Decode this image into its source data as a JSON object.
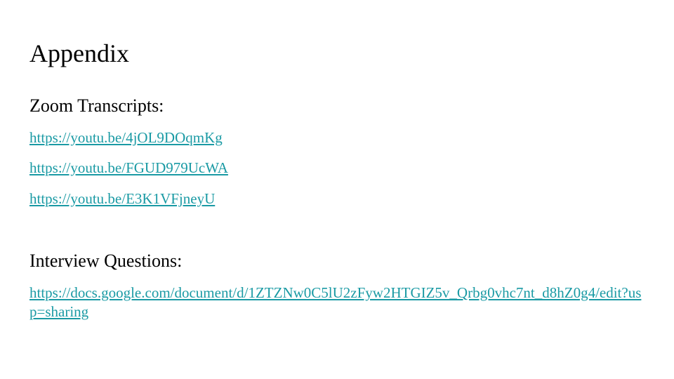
{
  "slide": {
    "title": "Appendix",
    "sections": [
      {
        "heading": "Zoom Transcripts:",
        "links": [
          "https://youtu.be/4jOL9DOqmKg",
          "https://youtu.be/FGUD979UcWA",
          "https://youtu.be/E3K1VFjneyU"
        ]
      },
      {
        "heading": "Interview Questions:",
        "links": [
          "https://docs.google.com/document/d/1ZTZNw0C5lU2zFyw2HTGIZ5v_Qrbg0vhc7nt_d8hZ0g4/edit?usp=sharing"
        ]
      }
    ]
  },
  "colors": {
    "link": "#1a9aa4",
    "text": "#000000",
    "background": "#ffffff"
  }
}
